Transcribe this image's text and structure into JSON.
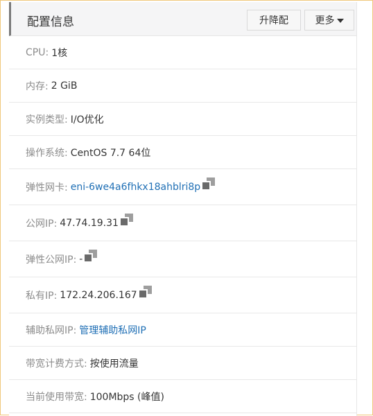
{
  "header": {
    "title": "配置信息",
    "upgrade_label": "升降配",
    "more_label": "更多"
  },
  "rows": [
    {
      "label": "CPU:",
      "value": "1核"
    },
    {
      "label": "内存:",
      "value": "2 GiB"
    },
    {
      "label": "实例类型:",
      "value": "I/O优化"
    },
    {
      "label": "操作系统:",
      "value": "CentOS 7.7 64位"
    },
    {
      "label": "弹性网卡:",
      "value": "eni-6we4a6fhkx18ahblri8p"
    },
    {
      "label": "公网IP:",
      "value": "47.74.19.31"
    },
    {
      "label": "弹性公网IP:",
      "value": "-"
    },
    {
      "label": "私有IP:",
      "value": "172.24.206.167"
    },
    {
      "label": "辅助私网IP:",
      "value": "管理辅助私网IP"
    },
    {
      "label": "带宽计费方式:",
      "value": "按使用流量"
    },
    {
      "label": "当前使用带宽:",
      "value": "100Mbps (峰值)"
    }
  ],
  "colors": {
    "link": "#1f6fb5",
    "label": "#8c8c8c",
    "header_bg": "#f5f5f6",
    "frame_border": "#f0c77a"
  },
  "icons": {
    "copy": "copy-icon",
    "caret": "caret-down-icon"
  }
}
